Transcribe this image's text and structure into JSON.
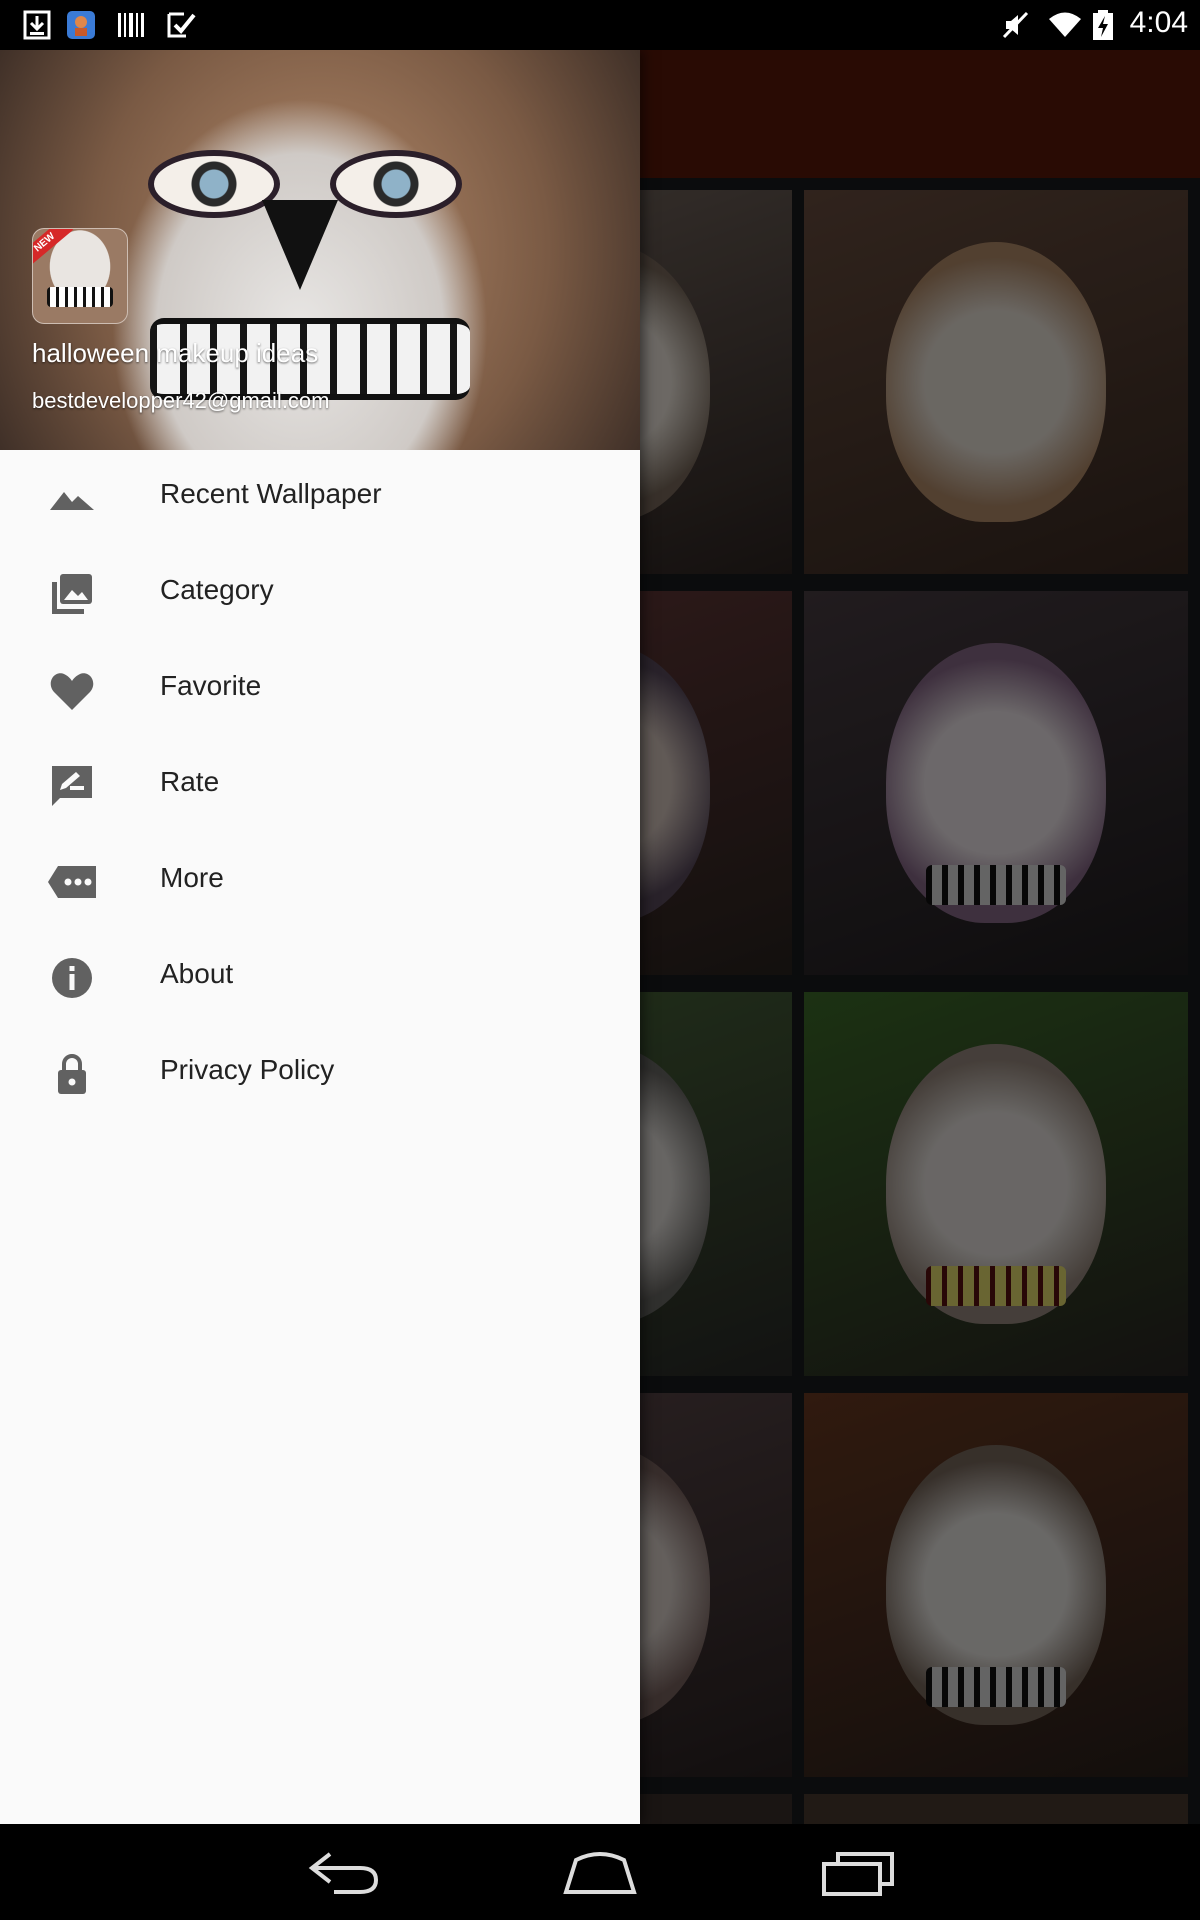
{
  "status_bar": {
    "time": "4:04",
    "left_icons": [
      "download-icon",
      "app-notification-icon",
      "barcode-icon",
      "task-check-icon"
    ],
    "right_icons": [
      "mute-icon",
      "wifi-icon",
      "battery-charging-icon"
    ]
  },
  "drawer": {
    "header": {
      "app_name": "halloween makeup ideas",
      "email": "bestdevelopper42@gmail.com",
      "badge": "NEW"
    },
    "items": [
      {
        "label": "Recent Wallpaper",
        "icon": "landscape-icon"
      },
      {
        "label": "Category",
        "icon": "photo-library-icon"
      },
      {
        "label": "Favorite",
        "icon": "heart-icon"
      },
      {
        "label": "Rate",
        "icon": "rate-review-icon"
      },
      {
        "label": "More",
        "icon": "more-tag-icon"
      },
      {
        "label": "About",
        "icon": "info-icon"
      },
      {
        "label": "Privacy Policy",
        "icon": "lock-icon"
      }
    ]
  },
  "nav_bar": {
    "buttons": [
      "back-icon",
      "home-icon",
      "recents-icon"
    ]
  },
  "colors": {
    "toolbar": "#5b1a0a",
    "drawer_bg": "#fafafa",
    "menu_icon": "#616161",
    "menu_text": "#222222"
  }
}
